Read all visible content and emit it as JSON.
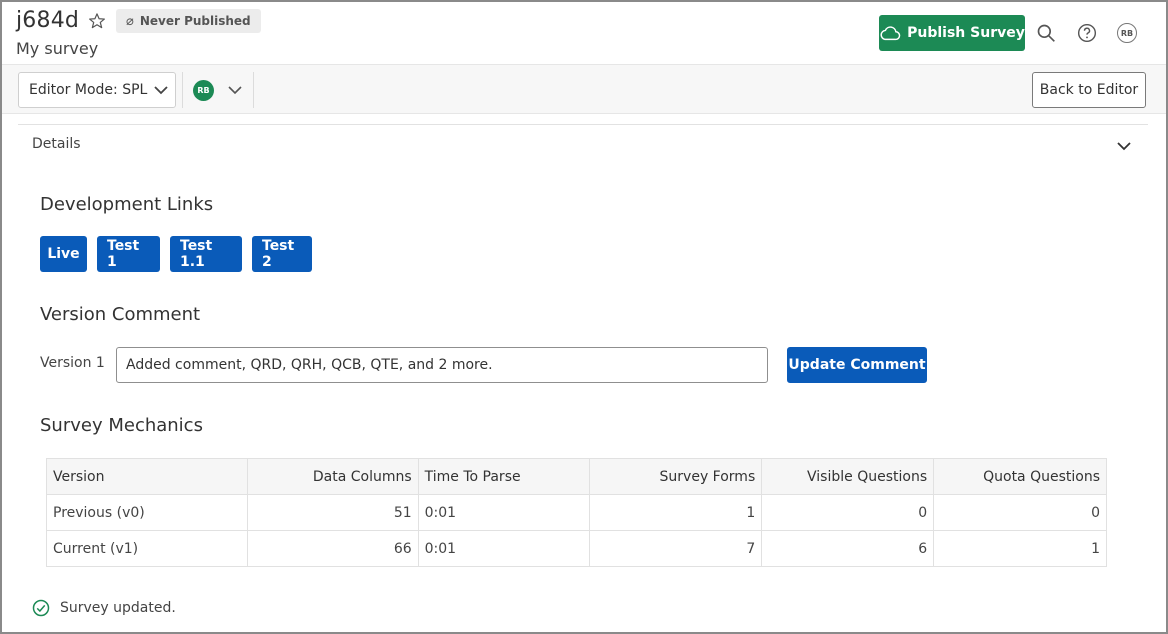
{
  "header": {
    "survey_id": "j684d",
    "publish_status": "Never Published",
    "survey_name": "My survey",
    "publish_button": "Publish Survey",
    "user_initials": "RB",
    "accent_color": "#1c8a55"
  },
  "toolbar": {
    "editor_mode": "Editor Mode: SPL",
    "user_initials": "RB",
    "back_button": "Back to Editor"
  },
  "details": {
    "label": "Details"
  },
  "development_links": {
    "title": "Development Links",
    "links": [
      "Live",
      "Test 1",
      "Test 1.1",
      "Test 2"
    ],
    "button_color": "#0a5bb9"
  },
  "version_comment": {
    "title": "Version Comment",
    "version_label": "Version 1",
    "comment_value": "Added comment, QRD, QRH, QCB, QTE, and 2 more.",
    "update_button": "Update Comment"
  },
  "survey_mechanics": {
    "title": "Survey Mechanics",
    "columns": [
      "Version",
      "Data Columns",
      "Time To Parse",
      "Survey Forms",
      "Visible Questions",
      "Quota Questions"
    ],
    "rows": [
      [
        "Previous (v0)",
        "51",
        "0:01",
        "1",
        "0",
        "0"
      ],
      [
        "Current (v1)",
        "66",
        "0:01",
        "7",
        "6",
        "1"
      ]
    ]
  },
  "status": {
    "message": "Survey updated.",
    "icon": "check-circle-icon"
  }
}
